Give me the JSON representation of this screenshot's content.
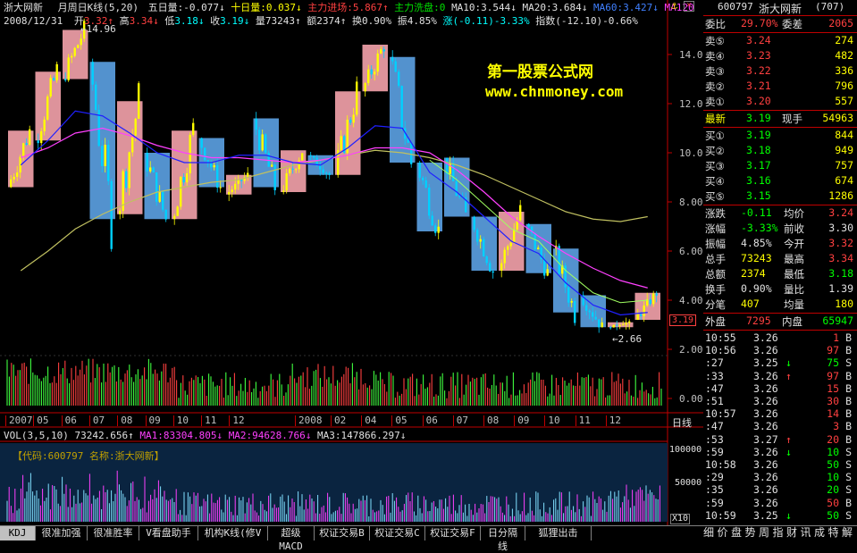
{
  "header": {
    "name": "浙大网新",
    "period": "月周日K线(5,20)",
    "ind1": "五日量:-0.077↓",
    "ind2": "十日量:0.037↓",
    "ind3": "主力进场:5.867↑",
    "ind4": "主力洗盘:0",
    "ma10": "MA10:3.544↓",
    "ma20": "MA20:3.684↓",
    "ma60": "MA60:3.427↓",
    "ma120": "MA120",
    "date": "2008/12/31",
    "open_label": "开",
    "open": "3.32↑",
    "high_label": "高",
    "high": "3.34↓",
    "low_label": "低",
    "low": "3.18↓",
    "close_label": "收",
    "close": "3.19↓",
    "vol": "量73243↑",
    "amt": "额2374↑",
    "turnover": "换0.90%",
    "amp": "振4.85%",
    "chg": "涨(-0.11)-3.33%",
    "index": "指数(-12.10)-0.66%"
  },
  "watermark": {
    "title": "第一股票公式网",
    "url": "www.chnmoney.com"
  },
  "price_axis": [
    "14.00",
    "12.00",
    "10.00",
    "8.00",
    "6.00",
    "4.00",
    "2.00",
    "0.00"
  ],
  "price_annotations": {
    "high": "14.96",
    "low": "2.66",
    "current": "3.19"
  },
  "date_axis": [
    "2007",
    "05",
    "06",
    "07",
    "08",
    "09",
    "10",
    "11",
    "12",
    "2008",
    "02",
    "04",
    "05",
    "06",
    "07",
    "08",
    "09",
    "10",
    "11",
    "12"
  ],
  "period_tab": "日线",
  "vol_bar": {
    "title": "VOL(3,5,10)",
    "v": "73242.656↑",
    "ma1": "MA1:83304.805↓",
    "ma2": "MA2:94628.766↓",
    "ma3": "MA3:147866.297↓",
    "code_label": "【代码:600797 名称:浙大网新】",
    "axis": [
      "100000",
      "50000"
    ],
    "unit": "X10"
  },
  "tabs": [
    "KDJ",
    "很准加强",
    "很准胜率",
    "V看盘助手",
    "机构K线(修V",
    "超级MACD",
    "权证交易B",
    "权证交易C",
    "权证交易F",
    "日分隔线",
    "狐狸出击"
  ],
  "quote": {
    "code": "600797",
    "name": "浙大网新",
    "num": "(707)",
    "weibi_label": "委比",
    "weibi": "29.70%",
    "weicha_label": "委差",
    "weicha": "2065",
    "sells": [
      {
        "label": "卖⑤",
        "price": "3.24",
        "vol": "274"
      },
      {
        "label": "卖④",
        "price": "3.23",
        "vol": "482"
      },
      {
        "label": "卖③",
        "price": "3.22",
        "vol": "336"
      },
      {
        "label": "卖②",
        "price": "3.21",
        "vol": "796"
      },
      {
        "label": "卖①",
        "price": "3.20",
        "vol": "557"
      }
    ],
    "latest_label": "最新",
    "latest": "3.19",
    "xianshou_label": "现手",
    "xianshou": "54963",
    "buys": [
      {
        "label": "买①",
        "price": "3.19",
        "vol": "844"
      },
      {
        "label": "买②",
        "price": "3.18",
        "vol": "949"
      },
      {
        "label": "买③",
        "price": "3.17",
        "vol": "757"
      },
      {
        "label": "买④",
        "price": "3.16",
        "vol": "674"
      },
      {
        "label": "买⑤",
        "price": "3.15",
        "vol": "1286"
      }
    ],
    "stats": [
      {
        "l1": "涨跌",
        "v1": "-0.11",
        "l2": "均价",
        "v2": "3.24"
      },
      {
        "l1": "涨幅",
        "v1": "-3.33%",
        "l2": "前收",
        "v2": "3.30"
      },
      {
        "l1": "振幅",
        "v1": "4.85%",
        "l2": "今开",
        "v2": "3.32"
      },
      {
        "l1": "总手",
        "v1": "73243",
        "l2": "最高",
        "v2": "3.34"
      },
      {
        "l1": "总额",
        "v1": "2374",
        "l2": "最低",
        "v2": "3.18"
      },
      {
        "l1": "换手",
        "v1": "0.90%",
        "l2": "量比",
        "v2": "1.39"
      },
      {
        "l1": "分笔",
        "v1": "407",
        "l2": "均量",
        "v2": "180"
      }
    ],
    "waipan_label": "外盘",
    "waipan": "7295",
    "neipan_label": "内盘",
    "neipan": "65947",
    "ticks": [
      {
        "t": "10:55",
        "p": "3.26",
        "a": "",
        "v": "1",
        "s": "B"
      },
      {
        "t": "10:56",
        "p": "3.26",
        "a": "",
        "v": "97",
        "s": "B"
      },
      {
        "t": ":27",
        "p": "3.25",
        "a": "↓",
        "v": "75",
        "s": "S"
      },
      {
        "t": ":33",
        "p": "3.26",
        "a": "↑",
        "v": "97",
        "s": "B"
      },
      {
        "t": ":47",
        "p": "3.26",
        "a": "",
        "v": "15",
        "s": "B"
      },
      {
        "t": ":51",
        "p": "3.26",
        "a": "",
        "v": "30",
        "s": "B"
      },
      {
        "t": "10:57",
        "p": "3.26",
        "a": "",
        "v": "14",
        "s": "B"
      },
      {
        "t": ":47",
        "p": "3.26",
        "a": "",
        "v": "3",
        "s": "B"
      },
      {
        "t": ":53",
        "p": "3.27",
        "a": "↑",
        "v": "20",
        "s": "B"
      },
      {
        "t": ":59",
        "p": "3.26",
        "a": "↓",
        "v": "10",
        "s": "S"
      },
      {
        "t": "10:58",
        "p": "3.26",
        "a": "",
        "v": "50",
        "s": "S"
      },
      {
        "t": ":29",
        "p": "3.26",
        "a": "",
        "v": "10",
        "s": "S"
      },
      {
        "t": ":35",
        "p": "3.26",
        "a": "",
        "v": "20",
        "s": "S"
      },
      {
        "t": ":59",
        "p": "3.26",
        "a": "",
        "v": "50",
        "s": "B"
      },
      {
        "t": "10:59",
        "p": "3.25",
        "a": "↓",
        "v": "50",
        "s": "S"
      }
    ],
    "bottom_tabs": [
      "细",
      "价",
      "盘",
      "势",
      "周",
      "指",
      "财",
      "讯",
      "成",
      "特",
      "解"
    ]
  },
  "chart_data": {
    "type": "candlestick",
    "title": "浙大网新 月周日K线(5,20)",
    "ylim": [
      0,
      16
    ],
    "monthly_boxes": [
      {
        "m": "2007-01",
        "o": 8.6,
        "c": 10.9
      },
      {
        "m": "2007-02",
        "o": 10.5,
        "c": 13.3
      },
      {
        "m": "2007-03",
        "o": 13.0,
        "c": 15.0
      },
      {
        "m": "2007-04",
        "o": 13.7,
        "c": 7.3
      },
      {
        "m": "2007-05",
        "o": 7.5,
        "c": 12.1
      },
      {
        "m": "2007-06",
        "o": 10.0,
        "c": 7.3
      },
      {
        "m": "2007-07",
        "o": 7.3,
        "c": 10.9
      },
      {
        "m": "2007-08",
        "o": 10.6,
        "c": 8.6
      },
      {
        "m": "2007-09",
        "o": 8.3,
        "c": 9.1
      },
      {
        "m": "2007-10",
        "o": 11.4,
        "c": 8.6
      },
      {
        "m": "2007-11",
        "o": 8.4,
        "c": 10.1
      },
      {
        "m": "2007-12",
        "o": 9.9,
        "c": 9.1
      },
      {
        "m": "2008-01",
        "o": 9.1,
        "c": 12.5
      },
      {
        "m": "2008-02",
        "o": 12.5,
        "c": 14.4
      },
      {
        "m": "2008-03",
        "o": 13.9,
        "c": 9.6
      },
      {
        "m": "2008-04",
        "o": 9.6,
        "c": 6.8
      },
      {
        "m": "2008-05",
        "o": 9.8,
        "c": 7.4
      },
      {
        "m": "2008-06",
        "o": 7.4,
        "c": 5.2
      },
      {
        "m": "2008-07",
        "o": 5.2,
        "c": 7.6
      },
      {
        "m": "2008-08",
        "o": 7.1,
        "c": 5.1
      },
      {
        "m": "2008-09",
        "o": 6.1,
        "c": 3.5
      },
      {
        "m": "2008-10",
        "o": 4.2,
        "c": 2.9
      },
      {
        "m": "2008-11",
        "o": 2.9,
        "c": 3.1
      },
      {
        "m": "2008-12",
        "o": 3.2,
        "c": 4.3
      }
    ],
    "ma_long": [
      5.2,
      6.0,
      6.9,
      7.5,
      8.0,
      8.4,
      8.6,
      8.8,
      8.9,
      9.2,
      9.5,
      9.7,
      9.9,
      10.1,
      10.0,
      9.8,
      9.5,
      9.1,
      8.6,
      8.1,
      7.6,
      7.3,
      7.2,
      7.4
    ],
    "ma_mid": [
      9.8,
      10.2,
      10.8,
      11.0,
      10.7,
      10.3,
      10.0,
      9.8,
      9.8,
      9.7,
      9.6,
      9.7,
      9.9,
      10.2,
      10.2,
      10.0,
      9.3,
      8.4,
      7.4,
      6.6,
      5.9,
      5.3,
      4.8,
      4.5
    ],
    "ma_short": [
      9.5,
      10.5,
      11.7,
      11.5,
      10.8,
      10.0,
      9.6,
      9.6,
      9.9,
      9.9,
      9.6,
      9.5,
      10.2,
      11.1,
      11.0,
      9.2,
      8.4,
      7.4,
      6.4,
      5.9,
      4.7,
      3.8,
      3.4,
      3.5
    ],
    "volume_axis": [
      0,
      100000
    ]
  }
}
